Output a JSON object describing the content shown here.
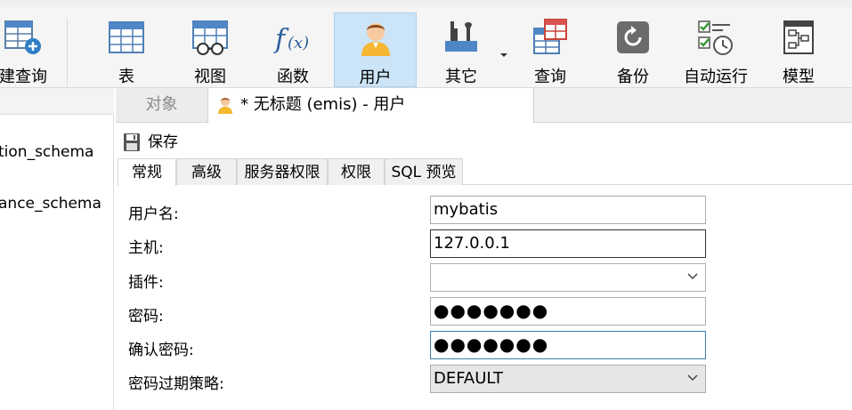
{
  "toolbar": {
    "items": [
      {
        "label": "建查询",
        "icon": "new-query-icon"
      },
      {
        "label": "表",
        "icon": "table-icon"
      },
      {
        "label": "视图",
        "icon": "view-icon"
      },
      {
        "label": "函数",
        "icon": "function-icon"
      },
      {
        "label": "用户",
        "icon": "user-icon"
      },
      {
        "label": "其它",
        "icon": "tools-icon"
      },
      {
        "label": "查询",
        "icon": "query-icon"
      },
      {
        "label": "备份",
        "icon": "backup-icon"
      },
      {
        "label": "自动运行",
        "icon": "schedule-icon"
      },
      {
        "label": "模型",
        "icon": "model-icon"
      }
    ],
    "active": "用户"
  },
  "sidebar": {
    "items": [
      {
        "label": "tion_schema"
      },
      {
        "label": "ance_schema"
      }
    ]
  },
  "tabs": {
    "objects_label": "对象",
    "doc_title": "* 无标题 (emis) - 用户"
  },
  "save": {
    "label": "保存"
  },
  "subtabs": [
    {
      "label": "常规"
    },
    {
      "label": "高级"
    },
    {
      "label": "服务器权限"
    },
    {
      "label": "权限"
    },
    {
      "label": "SQL 预览"
    }
  ],
  "form": {
    "username": {
      "label": "用户名:",
      "value": "mybatis"
    },
    "host": {
      "label": "主机:",
      "value": "127.0.0.1"
    },
    "plugin": {
      "label": "插件:",
      "value": ""
    },
    "password": {
      "label": "密码:",
      "value": "●●●●●●●"
    },
    "confirm": {
      "label": "确认密码:",
      "value": "●●●●●●●"
    },
    "policy": {
      "label": "密码过期策略:",
      "value": "DEFAULT"
    }
  },
  "colors": {
    "accent": "#cce4f7",
    "focus_border": "#3c7fb1"
  }
}
